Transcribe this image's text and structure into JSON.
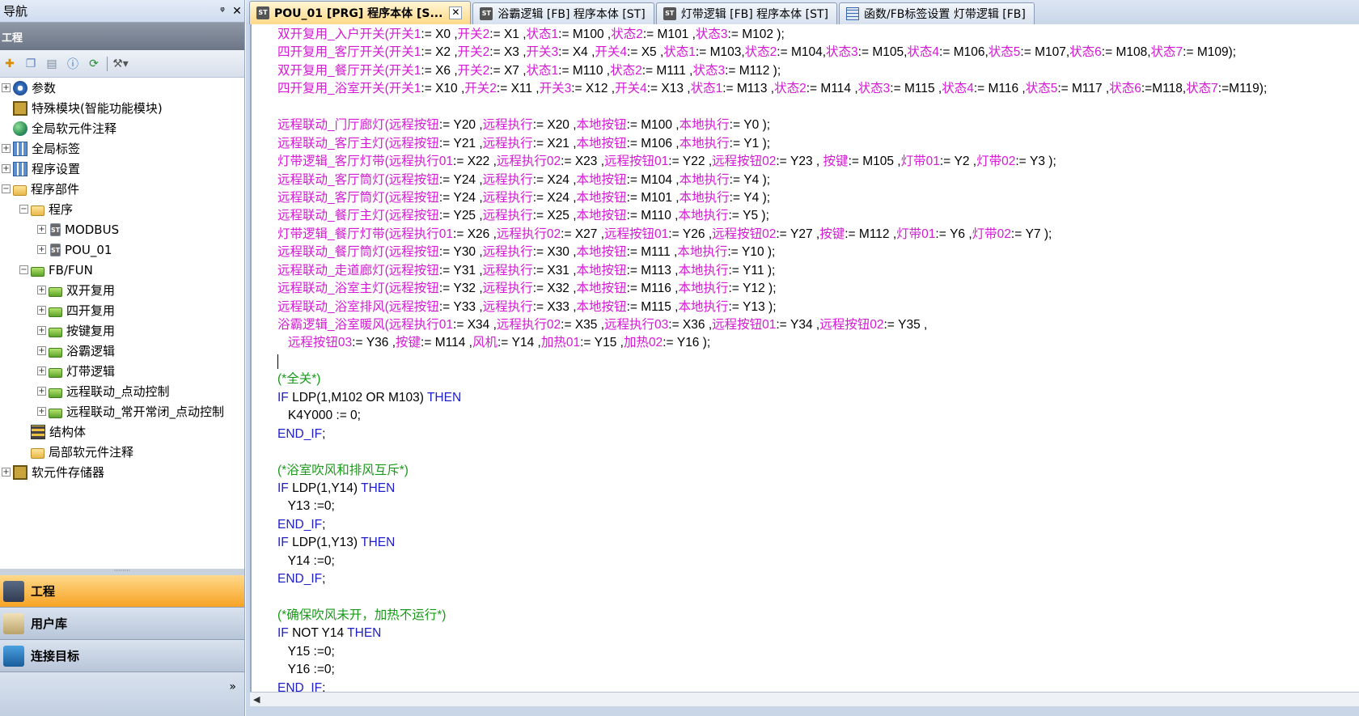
{
  "nav": {
    "title": "导航",
    "pin": "ᵠ",
    "close": "✕",
    "section": "工程",
    "toolbar_icons": [
      "new-item-icon",
      "copy-icon",
      "paste-icon",
      "properties-icon",
      "refresh-icon",
      "tools-icon"
    ],
    "tree": [
      {
        "label": "参数",
        "icon": "gear",
        "indent": 0,
        "expander": "+"
      },
      {
        "label": "特殊模块(智能功能模块)",
        "icon": "chip",
        "indent": 0,
        "expander": ""
      },
      {
        "label": "全局软元件注释",
        "icon": "globe",
        "indent": 0,
        "expander": ""
      },
      {
        "label": "全局标签",
        "icon": "grid",
        "indent": 0,
        "expander": "+"
      },
      {
        "label": "程序设置",
        "icon": "grid",
        "indent": 0,
        "expander": "+"
      },
      {
        "label": "程序部件",
        "icon": "folder",
        "indent": 0,
        "expander": "−"
      },
      {
        "label": "程序",
        "icon": "folder",
        "indent": 1,
        "expander": "−"
      },
      {
        "label": "MODBUS",
        "icon": "st",
        "indent": 2,
        "expander": "+"
      },
      {
        "label": "POU_01",
        "icon": "st",
        "indent": 2,
        "expander": "+"
      },
      {
        "label": "FB/FUN",
        "icon": "fb",
        "indent": 1,
        "expander": "−"
      },
      {
        "label": "双开复用",
        "icon": "fb",
        "indent": 2,
        "expander": "+"
      },
      {
        "label": "四开复用",
        "icon": "fb",
        "indent": 2,
        "expander": "+"
      },
      {
        "label": "按键复用",
        "icon": "fb",
        "indent": 2,
        "expander": "+"
      },
      {
        "label": "浴霸逻辑",
        "icon": "fb",
        "indent": 2,
        "expander": "+"
      },
      {
        "label": "灯带逻辑",
        "icon": "fb",
        "indent": 2,
        "expander": "+"
      },
      {
        "label": "远程联动_点动控制",
        "icon": "fb",
        "indent": 2,
        "expander": "+"
      },
      {
        "label": "远程联动_常开常闭_点动控制",
        "icon": "fb",
        "indent": 2,
        "expander": "+"
      },
      {
        "label": "结构体",
        "icon": "struct",
        "indent": 1,
        "expander": ""
      },
      {
        "label": "局部软元件注释",
        "icon": "folder",
        "indent": 1,
        "expander": ""
      },
      {
        "label": "软元件存储器",
        "icon": "chip",
        "indent": 0,
        "expander": "+"
      }
    ],
    "bottom_tabs": [
      {
        "label": "工程",
        "active": true
      },
      {
        "label": "用户库",
        "active": false
      },
      {
        "label": "连接目标",
        "active": false
      }
    ],
    "more": "»"
  },
  "tabs": [
    {
      "label": "POU_01 [PRG] 程序本体 [S...",
      "icon": "st",
      "active": true,
      "closable": true
    },
    {
      "label": "浴霸逻辑 [FB] 程序本体 [ST]",
      "icon": "st",
      "active": false,
      "closable": false
    },
    {
      "label": "灯带逻辑 [FB] 程序本体 [ST]",
      "icon": "st",
      "active": false,
      "closable": false
    },
    {
      "label": "函数/FB标签设置 灯带逻辑 [FB]",
      "icon": "label",
      "active": false,
      "closable": false
    }
  ],
  "code_lines": [
    [
      [
        "p",
        "双开复用_入户开关("
      ],
      [
        "p",
        "开关1"
      ],
      [
        "t",
        ":= X0 ,"
      ],
      [
        "p",
        "开关2"
      ],
      [
        "t",
        ":= X1 ,"
      ],
      [
        "p",
        "状态1"
      ],
      [
        "t",
        ":= M100 ,"
      ],
      [
        "p",
        "状态2"
      ],
      [
        "t",
        ":= M101 ,"
      ],
      [
        "p",
        "状态3"
      ],
      [
        "t",
        ":= M102 );"
      ]
    ],
    [
      [
        "p",
        "四开复用_客厅开关("
      ],
      [
        "p",
        "开关1"
      ],
      [
        "t",
        ":= X2 ,"
      ],
      [
        "p",
        "开关2"
      ],
      [
        "t",
        ":= X3 ,"
      ],
      [
        "p",
        "开关3"
      ],
      [
        "t",
        ":= X4 ,"
      ],
      [
        "p",
        "开关4"
      ],
      [
        "t",
        ":= X5 ,"
      ],
      [
        "p",
        "状态1"
      ],
      [
        "t",
        ":= M103,"
      ],
      [
        "p",
        "状态2"
      ],
      [
        "t",
        ":= M104,"
      ],
      [
        "p",
        "状态3"
      ],
      [
        "t",
        ":= M105,"
      ],
      [
        "p",
        "状态4"
      ],
      [
        "t",
        ":= M106,"
      ],
      [
        "p",
        "状态5"
      ],
      [
        "t",
        ":= M107,"
      ],
      [
        "p",
        "状态6"
      ],
      [
        "t",
        ":= M108,"
      ],
      [
        "p",
        "状态7"
      ],
      [
        "t",
        ":= M109);"
      ]
    ],
    [
      [
        "p",
        "双开复用_餐厅开关("
      ],
      [
        "p",
        "开关1"
      ],
      [
        "t",
        ":= X6 ,"
      ],
      [
        "p",
        "开关2"
      ],
      [
        "t",
        ":= X7 ,"
      ],
      [
        "p",
        "状态1"
      ],
      [
        "t",
        ":= M110 ,"
      ],
      [
        "p",
        "状态2"
      ],
      [
        "t",
        ":= M111 ,"
      ],
      [
        "p",
        "状态3"
      ],
      [
        "t",
        ":= M112 );"
      ]
    ],
    [
      [
        "p",
        "四开复用_浴室开关("
      ],
      [
        "p",
        "开关1"
      ],
      [
        "t",
        ":= X10 ,"
      ],
      [
        "p",
        "开关2"
      ],
      [
        "t",
        ":= X11 ,"
      ],
      [
        "p",
        "开关3"
      ],
      [
        "t",
        ":= X12 ,"
      ],
      [
        "p",
        "开关4"
      ],
      [
        "t",
        ":= X13 ,"
      ],
      [
        "p",
        "状态1"
      ],
      [
        "t",
        ":= M113 ,"
      ],
      [
        "p",
        "状态2"
      ],
      [
        "t",
        ":= M114 ,"
      ],
      [
        "p",
        "状态3"
      ],
      [
        "t",
        ":= M115 ,"
      ],
      [
        "p",
        "状态4"
      ],
      [
        "t",
        ":= M116 ,"
      ],
      [
        "p",
        "状态5"
      ],
      [
        "t",
        ":= M117 ,"
      ],
      [
        "p",
        "状态6"
      ],
      [
        "t",
        ":=M118,"
      ],
      [
        "p",
        "状态7"
      ],
      [
        "t",
        ":=M119);"
      ]
    ],
    [],
    [
      [
        "p",
        "远程联动_门厅廊灯("
      ],
      [
        "p",
        "远程按钮"
      ],
      [
        "t",
        ":= Y20 ,"
      ],
      [
        "p",
        "远程执行"
      ],
      [
        "t",
        ":= X20 ,"
      ],
      [
        "p",
        "本地按钮"
      ],
      [
        "t",
        ":= M100 ,"
      ],
      [
        "p",
        "本地执行"
      ],
      [
        "t",
        ":= Y0 );"
      ]
    ],
    [
      [
        "p",
        "远程联动_客厅主灯("
      ],
      [
        "p",
        "远程按钮"
      ],
      [
        "t",
        ":= Y21 ,"
      ],
      [
        "p",
        "远程执行"
      ],
      [
        "t",
        ":= X21 ,"
      ],
      [
        "p",
        "本地按钮"
      ],
      [
        "t",
        ":= M106 ,"
      ],
      [
        "p",
        "本地执行"
      ],
      [
        "t",
        ":= Y1 );"
      ]
    ],
    [
      [
        "p",
        "灯带逻辑_客厅灯带("
      ],
      [
        "p",
        "远程执行01"
      ],
      [
        "t",
        ":= X22 ,"
      ],
      [
        "p",
        "远程执行02"
      ],
      [
        "t",
        ":= X23 ,"
      ],
      [
        "p",
        "远程按钮01"
      ],
      [
        "t",
        ":= Y22 ,"
      ],
      [
        "p",
        "远程按钮02"
      ],
      [
        "t",
        ":= Y23 , "
      ],
      [
        "p",
        "按键"
      ],
      [
        "t",
        ":= M105 ,"
      ],
      [
        "p",
        "灯带01"
      ],
      [
        "t",
        ":= Y2 ,"
      ],
      [
        "p",
        "灯带02"
      ],
      [
        "t",
        ":= Y3 );"
      ]
    ],
    [
      [
        "p",
        "远程联动_客厅筒灯("
      ],
      [
        "p",
        "远程按钮"
      ],
      [
        "t",
        ":= Y24 ,"
      ],
      [
        "p",
        "远程执行"
      ],
      [
        "t",
        ":= X24 ,"
      ],
      [
        "p",
        "本地按钮"
      ],
      [
        "t",
        ":= M104 ,"
      ],
      [
        "p",
        "本地执行"
      ],
      [
        "t",
        ":= Y4 );"
      ]
    ],
    [
      [
        "p",
        "远程联动_客厅筒灯("
      ],
      [
        "p",
        "远程按钮"
      ],
      [
        "t",
        ":= Y24 ,"
      ],
      [
        "p",
        "远程执行"
      ],
      [
        "t",
        ":= X24 ,"
      ],
      [
        "p",
        "本地按钮"
      ],
      [
        "t",
        ":= M101 ,"
      ],
      [
        "p",
        "本地执行"
      ],
      [
        "t",
        ":= Y4 );"
      ]
    ],
    [
      [
        "p",
        "远程联动_餐厅主灯("
      ],
      [
        "p",
        "远程按钮"
      ],
      [
        "t",
        ":= Y25 ,"
      ],
      [
        "p",
        "远程执行"
      ],
      [
        "t",
        ":= X25 ,"
      ],
      [
        "p",
        "本地按钮"
      ],
      [
        "t",
        ":= M110 ,"
      ],
      [
        "p",
        "本地执行"
      ],
      [
        "t",
        ":= Y5 );"
      ]
    ],
    [
      [
        "p",
        "灯带逻辑_餐厅灯带("
      ],
      [
        "p",
        "远程执行01"
      ],
      [
        "t",
        ":= X26 ,"
      ],
      [
        "p",
        "远程执行02"
      ],
      [
        "t",
        ":= X27 ,"
      ],
      [
        "p",
        "远程按钮01"
      ],
      [
        "t",
        ":= Y26 ,"
      ],
      [
        "p",
        "远程按钮02"
      ],
      [
        "t",
        ":= Y27 ,"
      ],
      [
        "p",
        "按键"
      ],
      [
        "t",
        ":= M112 ,"
      ],
      [
        "p",
        "灯带01"
      ],
      [
        "t",
        ":= Y6 ,"
      ],
      [
        "p",
        "灯带02"
      ],
      [
        "t",
        ":= Y7 );"
      ]
    ],
    [
      [
        "p",
        "远程联动_餐厅筒灯("
      ],
      [
        "p",
        "远程按钮"
      ],
      [
        "t",
        ":= Y30 ,"
      ],
      [
        "p",
        "远程执行"
      ],
      [
        "t",
        ":= X30 ,"
      ],
      [
        "p",
        "本地按钮"
      ],
      [
        "t",
        ":= M111 ,"
      ],
      [
        "p",
        "本地执行"
      ],
      [
        "t",
        ":= Y10 );"
      ]
    ],
    [
      [
        "p",
        "远程联动_走道廊灯("
      ],
      [
        "p",
        "远程按钮"
      ],
      [
        "t",
        ":= Y31 ,"
      ],
      [
        "p",
        "远程执行"
      ],
      [
        "t",
        ":= X31 ,"
      ],
      [
        "p",
        "本地按钮"
      ],
      [
        "t",
        ":= M113 ,"
      ],
      [
        "p",
        "本地执行"
      ],
      [
        "t",
        ":= Y11 );"
      ]
    ],
    [
      [
        "p",
        "远程联动_浴室主灯("
      ],
      [
        "p",
        "远程按钮"
      ],
      [
        "t",
        ":= Y32 ,"
      ],
      [
        "p",
        "远程执行"
      ],
      [
        "t",
        ":= X32 ,"
      ],
      [
        "p",
        "本地按钮"
      ],
      [
        "t",
        ":= M116 ,"
      ],
      [
        "p",
        "本地执行"
      ],
      [
        "t",
        ":= Y12 );"
      ]
    ],
    [
      [
        "p",
        "远程联动_浴室排风("
      ],
      [
        "p",
        "远程按钮"
      ],
      [
        "t",
        ":= Y33 ,"
      ],
      [
        "p",
        "远程执行"
      ],
      [
        "t",
        ":= X33 ,"
      ],
      [
        "p",
        "本地按钮"
      ],
      [
        "t",
        ":= M115 ,"
      ],
      [
        "p",
        "本地执行"
      ],
      [
        "t",
        ":= Y13 );"
      ]
    ],
    [
      [
        "p",
        "浴霸逻辑_浴室暖风("
      ],
      [
        "p",
        "远程执行01"
      ],
      [
        "t",
        ":= X34 ,"
      ],
      [
        "p",
        "远程执行02"
      ],
      [
        "t",
        ":= X35 ,"
      ],
      [
        "p",
        "远程执行03"
      ],
      [
        "t",
        ":= X36 ,"
      ],
      [
        "p",
        "远程按钮01"
      ],
      [
        "t",
        ":= Y34 ,"
      ],
      [
        "p",
        "远程按钮02"
      ],
      [
        "t",
        ":= Y35 ,"
      ]
    ],
    [
      [
        "t",
        "   "
      ],
      [
        "p",
        "远程按钮03"
      ],
      [
        "t",
        ":= Y36 ,"
      ],
      [
        "p",
        "按键"
      ],
      [
        "t",
        ":= M114 ,"
      ],
      [
        "p",
        "风机"
      ],
      [
        "t",
        ":= Y14 ,"
      ],
      [
        "p",
        "加热01"
      ],
      [
        "t",
        ":= Y15 ,"
      ],
      [
        "p",
        "加热02"
      ],
      [
        "t",
        ":= Y16 );"
      ]
    ],
    [],
    [
      [
        "c",
        "(*全关*)"
      ]
    ],
    [
      [
        "k",
        "IF "
      ],
      [
        "t",
        "LDP(1,M102 OR M103) "
      ],
      [
        "k",
        "THEN"
      ]
    ],
    [
      [
        "t",
        "   K4Y000 := 0;"
      ]
    ],
    [
      [
        "k",
        "END_IF"
      ],
      [
        "t",
        ";"
      ]
    ],
    [],
    [
      [
        "c",
        "(*浴室吹风和排风互斥*)"
      ]
    ],
    [
      [
        "k",
        "IF "
      ],
      [
        "t",
        "LDP(1,Y14) "
      ],
      [
        "k",
        "THEN"
      ]
    ],
    [
      [
        "t",
        "   Y13 :=0;"
      ]
    ],
    [
      [
        "k",
        "END_IF"
      ],
      [
        "t",
        ";"
      ]
    ],
    [
      [
        "k",
        "IF "
      ],
      [
        "t",
        "LDP(1,Y13) "
      ],
      [
        "k",
        "THEN"
      ]
    ],
    [
      [
        "t",
        "   Y14 :=0;"
      ]
    ],
    [
      [
        "k",
        "END_IF"
      ],
      [
        "t",
        ";"
      ]
    ],
    [],
    [
      [
        "c",
        "(*确保吹风未开，加热不运行*)"
      ]
    ],
    [
      [
        "k",
        "IF "
      ],
      [
        "t",
        "NOT Y14 "
      ],
      [
        "k",
        "THEN"
      ]
    ],
    [
      [
        "t",
        "   Y15 :=0;"
      ]
    ],
    [
      [
        "t",
        "   Y16 :=0;"
      ]
    ],
    [
      [
        "k",
        "END_IF"
      ],
      [
        "t",
        ";"
      ]
    ]
  ],
  "caret_line": 18
}
